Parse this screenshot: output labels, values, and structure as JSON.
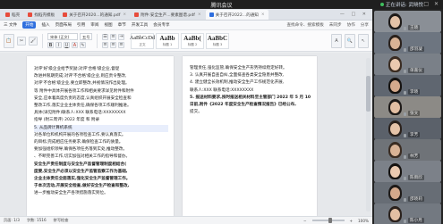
{
  "meeting": {
    "title": "腾讯会议",
    "status": "正在讲话: 武晓悦",
    "participants": [
      {
        "name": "王晓",
        "bg": "#8a8f96"
      },
      {
        "name": "邵羽凝",
        "bg": "#6d7580"
      },
      {
        "name": "单嘉仪",
        "bg": "#7a8088"
      },
      {
        "name": "李晓",
        "bg": "#5f6670"
      },
      {
        "name": "张文",
        "bg": "#8c8a86"
      },
      {
        "name": "李芳",
        "bg": "#5b616a"
      },
      {
        "name": "林芳",
        "bg": "#6f7378"
      },
      {
        "name": "陈雨欣",
        "bg": "#7c8189"
      },
      {
        "name": "邵晓莉",
        "bg": "#676d75"
      },
      {
        "name": "陈小月",
        "bg": "#737981"
      }
    ]
  },
  "wps": {
    "tabs": [
      {
        "label": "稻壳",
        "color": "#e74c3c",
        "active": false
      },
      {
        "label": "找稻壳模板",
        "color": "#e74c3c",
        "active": false
      },
      {
        "label": "关于召开2020...的通知.pdf",
        "color": "#e74c3c",
        "active": false
      },
      {
        "label": "附件:安全生产...要素图谱.pdf",
        "color": "#e74c3c",
        "active": false
      },
      {
        "label": "关于召开2022...的通知",
        "color": "#2f6fde",
        "active": true
      }
    ],
    "menus": [
      "三 文件",
      "开始",
      "插入",
      "页面布局",
      "引用",
      "审阅",
      "视图",
      "章节",
      "开发工具",
      "会员专享"
    ],
    "active_menu": "开始",
    "menu_right": [
      "查找命令、搜索模板",
      "未同步",
      "协作",
      "分享"
    ],
    "font_name": "宋体 (正文)",
    "font_size": "五号",
    "styles": [
      {
        "sample": "AaBbCcDd",
        "name": "正文"
      },
      {
        "sample": "AaBb",
        "name": "标题 1"
      },
      {
        "sample": "AaBb(",
        "name": "标题 2"
      },
      {
        "sample": "AaBbC",
        "name": "标题 3"
      }
    ],
    "page1_lines": [
      "对评'好'级企业给予奖励;对评'合格'级企业,督促",
      "改进并限期完成;对评'不合格'级企业,则应责令整改,",
      "对评'不合格'级企业,要立即整改,并视情况作出处理。",
      "等 附件中具体开展各项工作和相关要求详见附件和附件",
      "安全,应本着高度负责的态度,认真组织开展安全检查和",
      "整改工作,落实企业主体责任,确保各项工作顺利推进。",
      "具体(详见附件)联系人:XXX 联系电话:XXXXXXXX",
      "指导 (附三周评) 2022 年度 和 附录",
      "",
      "5. 从品牌计算机系统",
      "",
      "对各单位和机构开展的各项检查工作,要认真落实。",
      "的目标,完成相应任务要求,确保检查工作的质量。",
      "要加强组织领导,确保各项任务落到实处,推动整改。",
      "、不断完善工作,切实加强对相关工作的指导和督办。",
      "安全生产责任制度与安全生产监督管理制度相结合(",
      "度要,安全生产必须以安全生产监管监察工作为基础,",
      "企业主体责任全面落实,强化安全生产监督管理工作。",
      "于本次活动,开展安全检查,做好安全生产检查和整改,",
      "进一步推动安全生产各项措施落实到位。"
    ],
    "page2_lines": [
      "管理责任,强化监管,确保安全生产形势持续稳定好转。",
      "",
      "3. 认真开展自查自纠,全面排查各类安全隐患并整改,",
      "4. 建立健全长效机制,推动安全生产工作规范化开展,",
      "",
      "联系人:XXX 联系电话:XXXXXXXX",
      "",
      "5. 报送材料要求,按时报送相关材料至主管部门 2022 年 5 月 10",
      "日前,附件《2022 年度安全生产检查情况报告》已经公布,",
      "提交。"
    ],
    "status": {
      "page": "页面: 1/3",
      "words": "字数: 1516",
      "check": "拼写检查",
      "zoom": "100%"
    }
  }
}
